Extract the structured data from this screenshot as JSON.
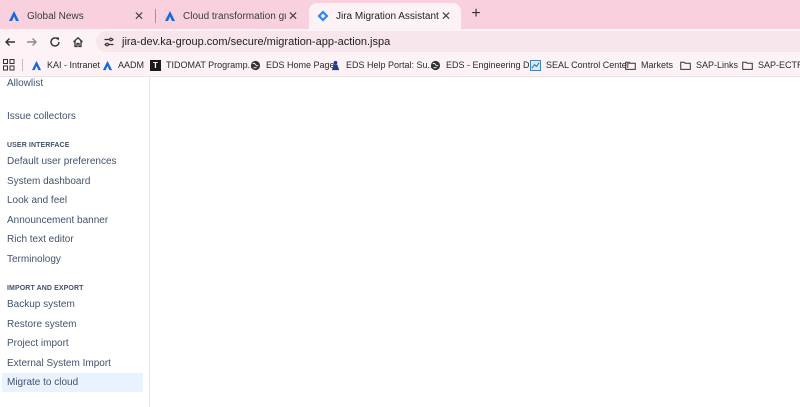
{
  "tabs": [
    {
      "title": "Global News",
      "icon": "atlassian-icon"
    },
    {
      "title": "Cloud transformation guide | A",
      "icon": "atlassian-icon"
    },
    {
      "title": "Jira Migration Assistant - KA JIR",
      "icon": "jira-icon",
      "active": true
    }
  ],
  "toolbar": {
    "url": "jira-dev.ka-group.com/secure/migration-app-action.jspa"
  },
  "bookmarks": [
    {
      "label": "KAI - Intranet",
      "icon": "atlassian-icon"
    },
    {
      "label": "AADM",
      "icon": "atlassian-icon"
    },
    {
      "label": "TIDOMAT Programp...",
      "icon": "tidomat-icon"
    },
    {
      "label": "EDS Home Page",
      "icon": "globe-icon"
    },
    {
      "label": "EDS Help Portal: Su...",
      "icon": "help-portal-icon"
    },
    {
      "label": "EDS - Engineering D...",
      "icon": "globe-icon"
    },
    {
      "label": "SEAL Control Center",
      "icon": "seal-icon"
    },
    {
      "label": "Markets",
      "icon": "folder-icon"
    },
    {
      "label": "SAP-Links",
      "icon": "folder-icon"
    },
    {
      "label": "SAP-ECTR",
      "icon": "folder-icon"
    }
  ],
  "sidebar": {
    "top_items": [
      "Allowlist",
      "Issue collectors"
    ],
    "ui_heading": "USER INTERFACE",
    "ui_items": [
      "Default user preferences",
      "System dashboard",
      "Look and feel",
      "Announcement banner",
      "Rich text editor",
      "Terminology"
    ],
    "ie_heading": "IMPORT AND EXPORT",
    "ie_items": [
      "Backup system",
      "Restore system",
      "Project import",
      "External System Import",
      "Migrate to cloud"
    ],
    "selected_item": "Migrate to cloud"
  },
  "colors": {
    "tabstrip_bg": "#f9d0dd",
    "toolbar_bg": "#fdf2f5",
    "sidebar_text": "#42526e",
    "selected_bg": "#e9f2ff",
    "atlassian_blue": "#1868db"
  }
}
